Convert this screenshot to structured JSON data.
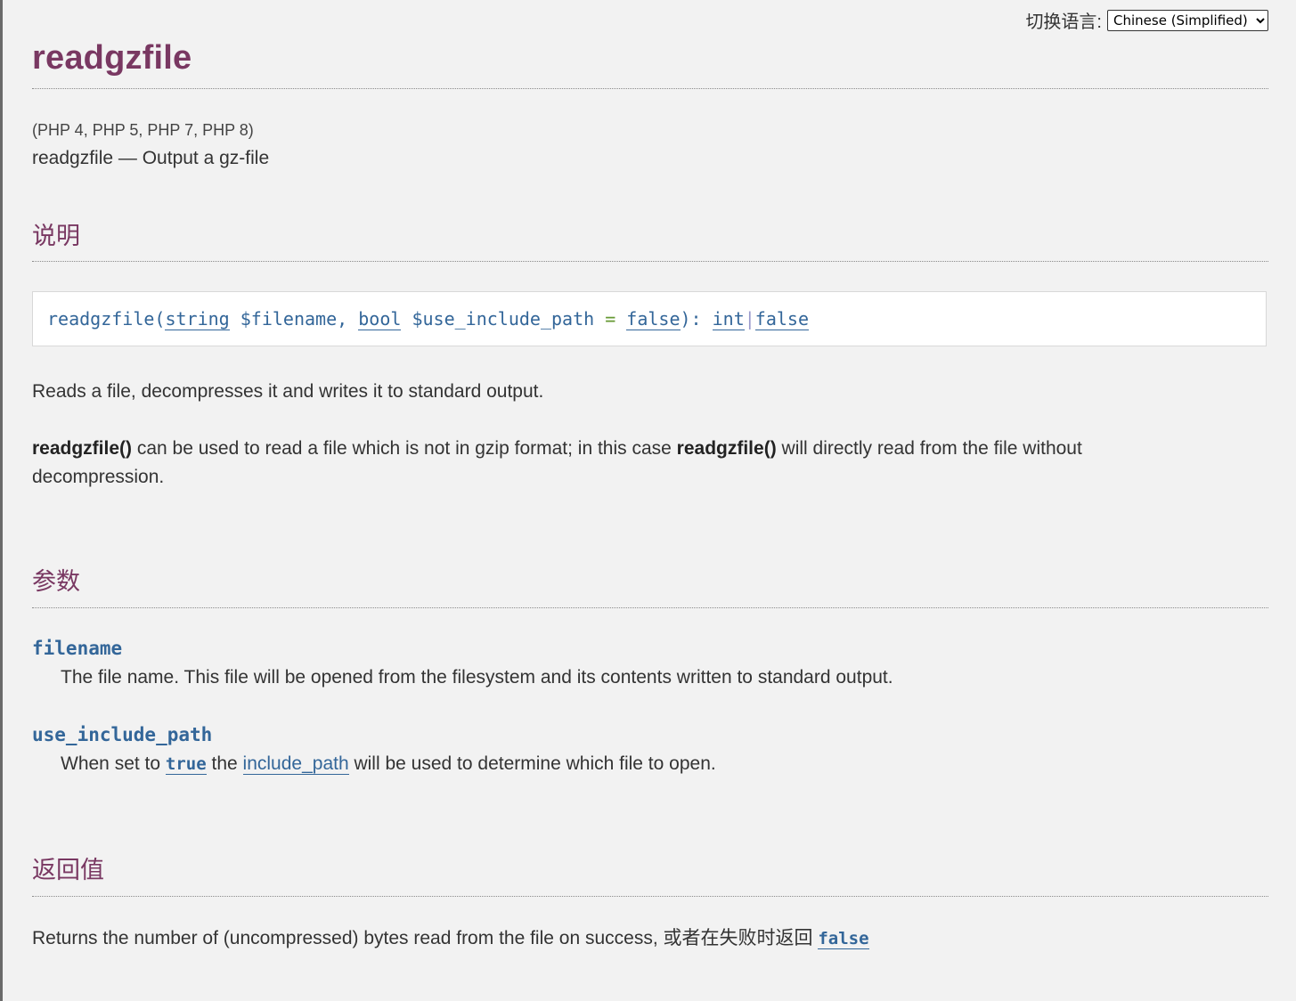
{
  "language_switch": {
    "label": "切换语言:",
    "selected": "Chinese (Simplified)"
  },
  "refname": "readgzfile",
  "versions": "(PHP 4, PHP 5, PHP 7, PHP 8)",
  "purpose": "readgzfile — Output a gz-file",
  "sections": {
    "description": "说明",
    "parameters": "参数",
    "return_values": "返回值"
  },
  "synopsis": {
    "func": "readgzfile",
    "open": "(",
    "type1": "string",
    "param1": " $filename",
    "sep": ", ",
    "type2": "bool",
    "param2": " $use_include_path",
    "eq": " = ",
    "default2": "false",
    "close": "): ",
    "ret1": "int",
    "pipe": "|",
    "ret2": "false"
  },
  "description": {
    "p1": "Reads a file, decompresses it and writes it to standard output.",
    "p2_fn1": "readgzfile()",
    "p2_mid": " can be used to read a file which is not in gzip format; in this case ",
    "p2_fn2": "readgzfile()",
    "p2_end": " will directly read from the file without decompression."
  },
  "parameters": {
    "filename": {
      "term": "filename",
      "desc": "The file name. This file will be opened from the filesystem and its contents written to standard output."
    },
    "use_include_path": {
      "term": "use_include_path",
      "desc_pre": "When set to ",
      "true_link": "true",
      "desc_mid": " the ",
      "include_path_link": "include_path",
      "desc_post": " will be used to determine which file to open."
    }
  },
  "return_values": {
    "text": "Returns the number of (uncompressed) bytes read from the file on success, 或者在失败时返回 ",
    "false_link": "false"
  }
}
